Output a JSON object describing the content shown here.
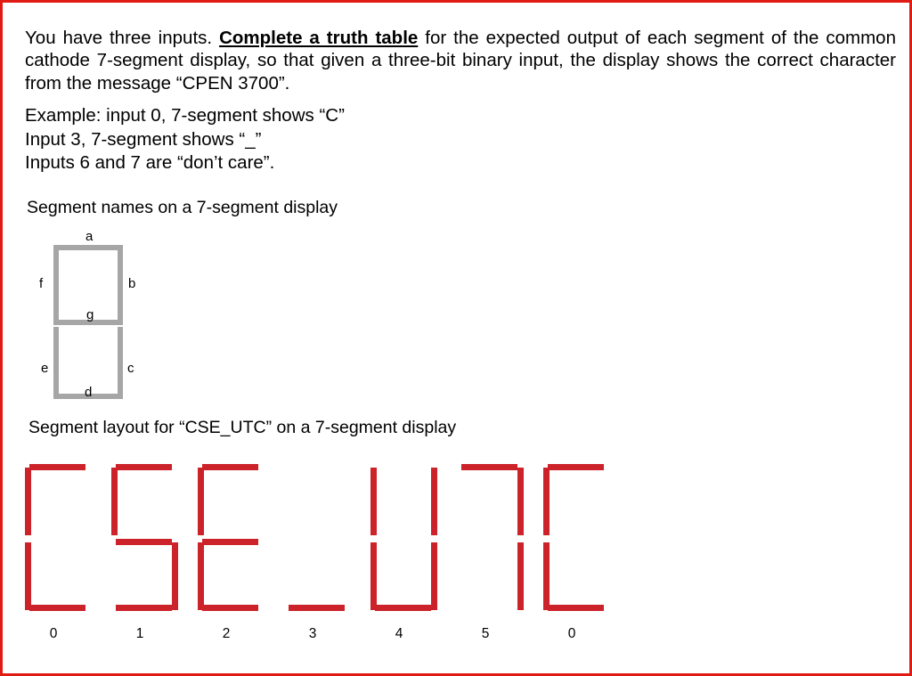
{
  "page": {
    "border_color": "#e01b14",
    "background": "#ffffff"
  },
  "intro": {
    "part1": "You have three inputs. ",
    "emphasis": "Complete a truth table",
    "part2": " for the expected output of each segment of the common cathode 7-segment display, so that given a three-bit binary input, the display shows the correct character from the message “CPEN 3700”."
  },
  "examples": {
    "line1": "Example: input 0, 7-segment shows “C”",
    "line2": "Input 3, 7-segment shows “_”",
    "line3": "Inputs 6 and 7 are “don’t care”."
  },
  "headings": {
    "segment_names": "Segment names on a 7-segment display",
    "segment_layout": "Segment layout for “CSE_UTC” on a 7-segment display"
  },
  "segment_name_diagram": {
    "bar_color": "#a6a6a6",
    "labels": {
      "a": "a",
      "b": "b",
      "c": "c",
      "d": "d",
      "e": "e",
      "f": "f",
      "g": "g"
    }
  },
  "big_display": {
    "segment_color": "#cc2229",
    "message": "CSE_UTC",
    "digits": [
      {
        "input": "0",
        "character": "C",
        "segments": {
          "a": true,
          "b": false,
          "c": false,
          "d": true,
          "e": true,
          "f": true,
          "g": false
        }
      },
      {
        "input": "1",
        "character": "S",
        "segments": {
          "a": true,
          "b": false,
          "c": true,
          "d": true,
          "e": false,
          "f": true,
          "g": true
        }
      },
      {
        "input": "2",
        "character": "E",
        "segments": {
          "a": true,
          "b": false,
          "c": false,
          "d": true,
          "e": true,
          "f": true,
          "g": true
        }
      },
      {
        "input": "3",
        "character": "_",
        "segments": {
          "a": false,
          "b": false,
          "c": false,
          "d": true,
          "e": false,
          "f": false,
          "g": false
        }
      },
      {
        "input": "4",
        "character": "U",
        "segments": {
          "a": false,
          "b": true,
          "c": true,
          "d": true,
          "e": true,
          "f": true,
          "g": false
        }
      },
      {
        "input": "5",
        "character": "T",
        "segments": {
          "a": true,
          "b": true,
          "c": true,
          "d": false,
          "e": false,
          "f": false,
          "g": false
        }
      },
      {
        "input": "0",
        "character": "C",
        "segments": {
          "a": true,
          "b": false,
          "c": false,
          "d": true,
          "e": true,
          "f": true,
          "g": false
        }
      }
    ]
  }
}
